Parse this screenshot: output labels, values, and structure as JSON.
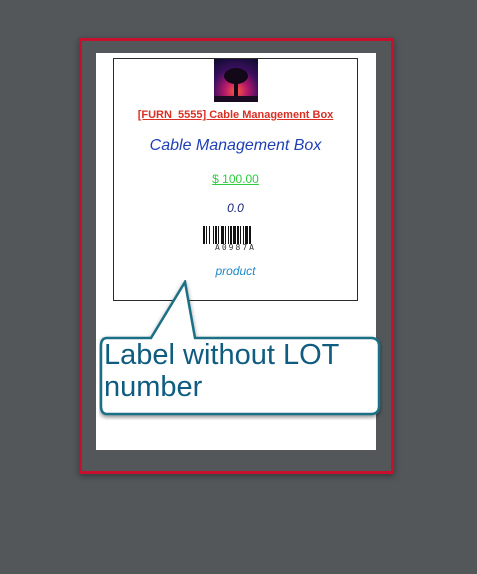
{
  "label": {
    "reference": "[FURN_5555] Cable Management Box",
    "product_name": "Cable Management Box",
    "price": "$ 100.00",
    "quantity": "0.0",
    "barcode_value": "A0987A",
    "type": "product",
    "image_icon": "product-photo-tree-sunset"
  },
  "callout": {
    "text": "Label without LOT number"
  },
  "colors": {
    "background": "#53575a",
    "frame_border": "#c8102e",
    "reference_link": "#d93025",
    "product_name": "#1f3fb4",
    "price": "#2ecc40",
    "quantity": "#1a237e",
    "type_label": "#1e88c8",
    "callout_text": "#0f5c80",
    "callout_border": "#1b6f86"
  }
}
